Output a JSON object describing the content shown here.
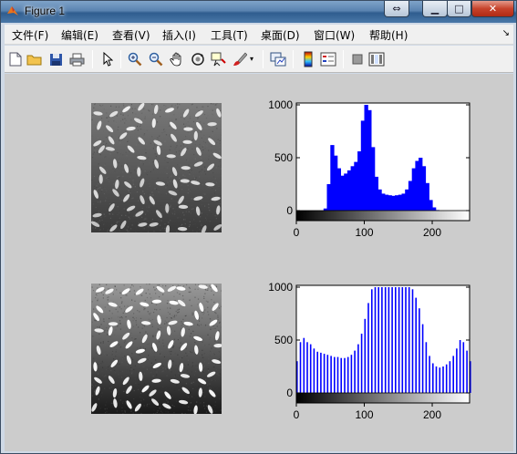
{
  "window": {
    "title": "Figure 1",
    "restore_symbol": "⇔",
    "min_symbol": "▁",
    "max_symbol": "□",
    "close_symbol": "✕"
  },
  "menu": {
    "items": [
      "文件(F)",
      "编辑(E)",
      "查看(V)",
      "插入(I)",
      "工具(T)",
      "桌面(D)",
      "窗口(W)",
      "帮助(H)"
    ],
    "overflow_symbol": "↘"
  },
  "toolbar": {
    "icons": [
      "new-figure-icon",
      "open-file-icon",
      "save-icon",
      "print-icon",
      "pointer-icon",
      "zoom-in-icon",
      "zoom-out-icon",
      "pan-hand-icon",
      "rotate-3d-icon",
      "data-cursor-icon",
      "brush-icon",
      "brush-dropdown-icon",
      "link-plot-icon",
      "colorbar-icon",
      "legend-icon",
      "hide-plot-tools-icon",
      "show-plot-tools-icon"
    ]
  },
  "colors": {
    "histogram_bar": "#0000ff",
    "figure_background": "#cccccc",
    "axes_background": "#ffffff"
  },
  "chart_data": [
    {
      "type": "bar",
      "title": "",
      "xlabel": "",
      "ylabel": "",
      "xlim": [
        0,
        255
      ],
      "ylim": [
        0,
        1000
      ],
      "xticks": [
        "0",
        "100",
        "200"
      ],
      "yticks": [
        "0",
        "500",
        "1000"
      ],
      "colorbar": "grayscale 0-255",
      "series": [
        {
          "bins": [
            40,
            45,
            50,
            55,
            60,
            65,
            70,
            75,
            80,
            85,
            90,
            95,
            100,
            105,
            110,
            115,
            120,
            125,
            130,
            135,
            140,
            145,
            150,
            155,
            160,
            165,
            170,
            175,
            180,
            185,
            190,
            195,
            200,
            205
          ],
          "values": [
            20,
            250,
            620,
            520,
            400,
            330,
            350,
            380,
            420,
            460,
            560,
            850,
            1000,
            950,
            600,
            320,
            200,
            160,
            150,
            145,
            140,
            145,
            150,
            160,
            200,
            280,
            400,
            470,
            500,
            420,
            260,
            100,
            30,
            5
          ]
        }
      ]
    },
    {
      "type": "bar",
      "title": "",
      "xlabel": "",
      "ylabel": "",
      "xlim": [
        0,
        255
      ],
      "ylim": [
        0,
        1000
      ],
      "xticks": [
        "0",
        "100",
        "200"
      ],
      "yticks": [
        "0",
        "500",
        "1000"
      ],
      "colorbar": "grayscale 0-255",
      "series": [
        {
          "bins": [
            0,
            5,
            10,
            15,
            20,
            25,
            30,
            35,
            40,
            45,
            50,
            55,
            60,
            65,
            70,
            75,
            80,
            85,
            90,
            95,
            100,
            105,
            110,
            115,
            120,
            125,
            130,
            135,
            140,
            145,
            150,
            155,
            160,
            165,
            170,
            175,
            180,
            185,
            190,
            195,
            200,
            205,
            210,
            215,
            220,
            225,
            230,
            235,
            240,
            245,
            250,
            255
          ],
          "values": [
            300,
            480,
            520,
            480,
            460,
            420,
            390,
            380,
            370,
            360,
            350,
            340,
            340,
            330,
            330,
            340,
            360,
            400,
            460,
            560,
            700,
            850,
            980,
            1000,
            1000,
            1000,
            1000,
            1000,
            1000,
            1000,
            1000,
            1000,
            1000,
            1000,
            980,
            900,
            800,
            650,
            480,
            350,
            280,
            250,
            240,
            250,
            270,
            300,
            350,
            420,
            500,
            480,
            400,
            300
          ]
        }
      ]
    }
  ]
}
